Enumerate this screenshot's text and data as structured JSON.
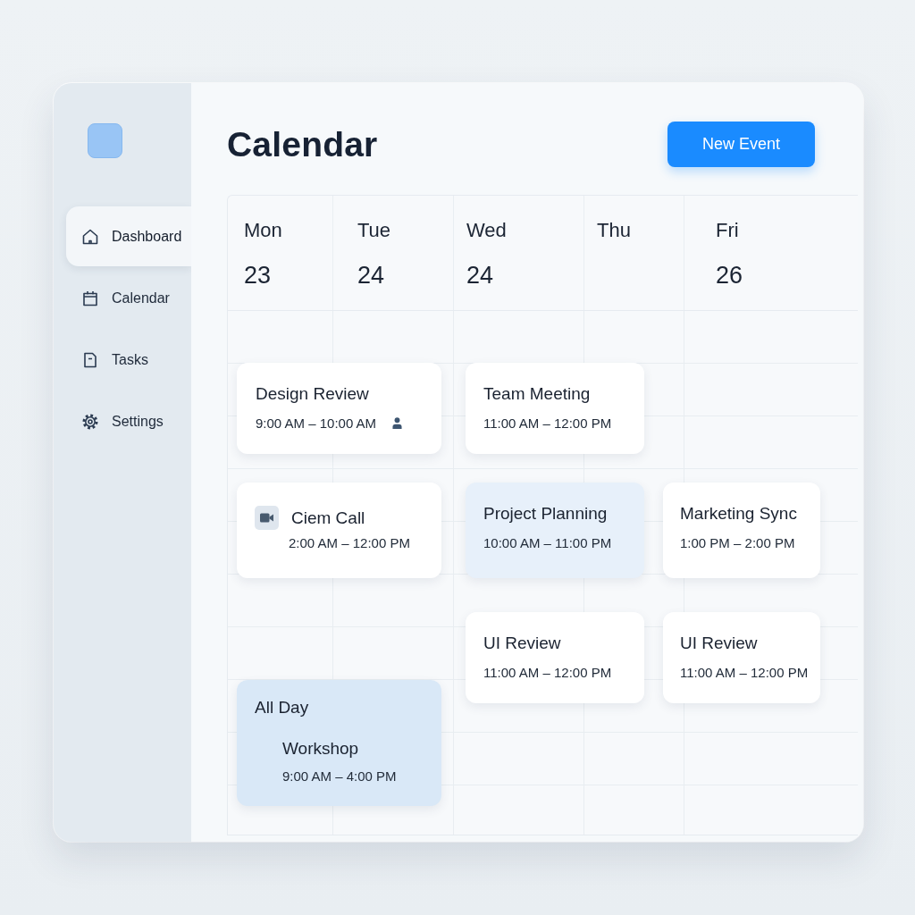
{
  "sidebar": {
    "items": [
      {
        "label": "Dashboard",
        "selected": true
      },
      {
        "label": "Calendar",
        "selected": false
      },
      {
        "label": "Tasks",
        "selected": false
      },
      {
        "label": "Settings",
        "selected": false
      }
    ]
  },
  "header": {
    "title": "Calendar",
    "button": "New Event"
  },
  "calendar": {
    "days": [
      {
        "name": "Mon",
        "date": "23"
      },
      {
        "name": "Tue",
        "date": "24"
      },
      {
        "name": "Wed",
        "date": "24"
      },
      {
        "name": "Thu"
      },
      {
        "name": "Fri",
        "date": "26"
      }
    ],
    "events": [
      {
        "kind": "attendee",
        "title": "Design Review",
        "time": "9:00 AM – 10:00 AM",
        "color": "#ffffff"
      },
      {
        "kind": "timed",
        "title": "Team Meeting",
        "time": "11:00 AM – 12:00 PM",
        "color": "#ffffff"
      },
      {
        "kind": "video",
        "title": "Ciem Call",
        "time": "2:00 AM – 12:00 PM",
        "color": "#ffffff"
      },
      {
        "kind": "timed",
        "title": "Project Planning",
        "time": "10:00 AM – 11:00 PM",
        "color": "#e7f0fa"
      },
      {
        "kind": "timed",
        "title": "Marketing Sync",
        "time": "1:00 PM – 2:00 PM",
        "color": "#ffffff"
      },
      {
        "kind": "timed",
        "title": "UI Review",
        "time": "11:00 AM – 12:00 PM",
        "color": "#ffffff"
      },
      {
        "kind": "timed",
        "title": "UI Review",
        "time": "11:00 AM – 12:00 PM",
        "color": "#ffffff"
      },
      {
        "kind": "all_day",
        "label": "All Day",
        "title": "Workshop",
        "time": "9:00 AM – 4:00 PM",
        "color": "#d9e8f7"
      }
    ]
  }
}
